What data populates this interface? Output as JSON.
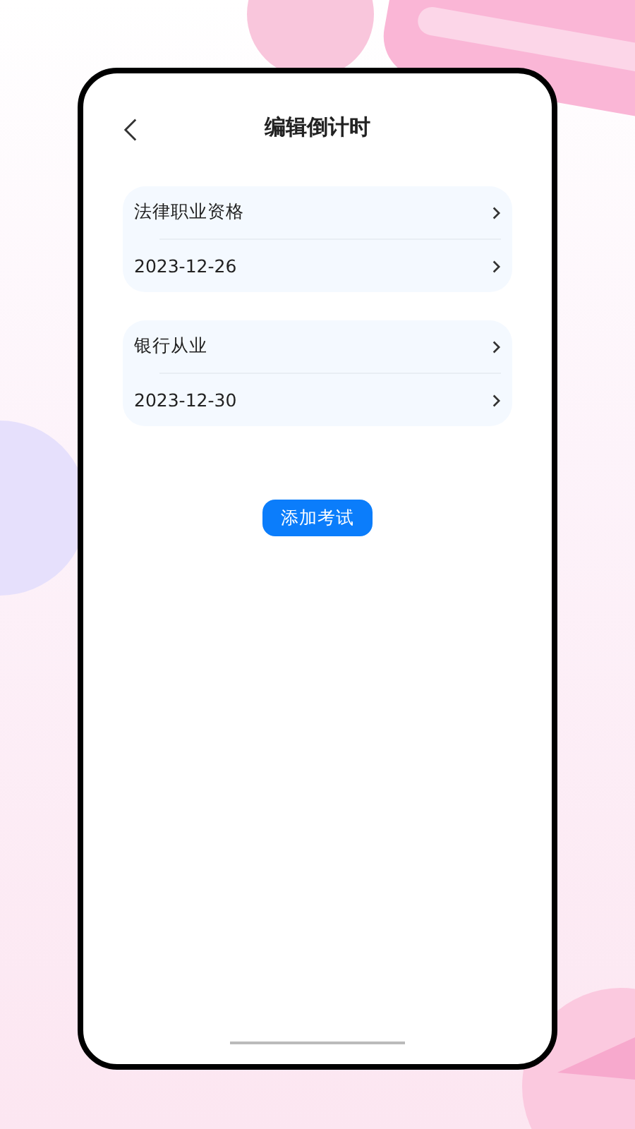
{
  "header": {
    "title": "编辑倒计时"
  },
  "exams": [
    {
      "name": "法律职业资格",
      "date": "2023-12-26"
    },
    {
      "name": "银行从业",
      "date": "2023-12-30"
    }
  ],
  "add_button": {
    "label": "添加考试"
  }
}
